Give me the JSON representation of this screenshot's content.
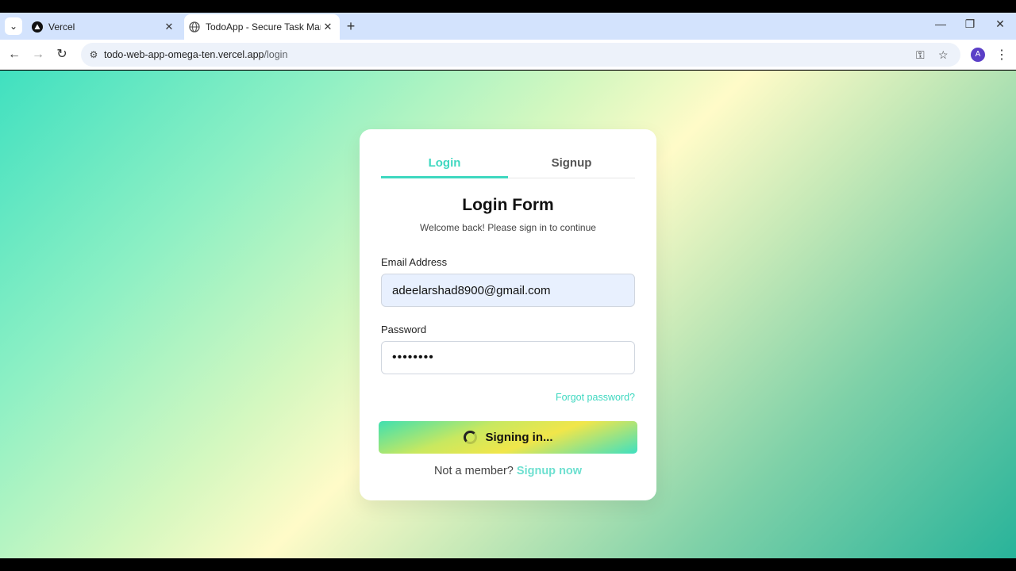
{
  "browser": {
    "tabs": [
      {
        "title": "Vercel",
        "active": false
      },
      {
        "title": "TodoApp - Secure Task Manage",
        "active": true
      }
    ],
    "url_host": "todo-web-app-omega-ten.vercel.app",
    "url_path": "/login",
    "profile_initial": "A"
  },
  "auth": {
    "tab_login": "Login",
    "tab_signup": "Signup",
    "title": "Login Form",
    "subtitle": "Welcome back! Please sign in to continue",
    "email_label": "Email Address",
    "email_value": "adeelarshad8900@gmail.com",
    "password_label": "Password",
    "password_mask": "••••••••",
    "forgot": "Forgot password?",
    "submit": "Signing in...",
    "not_member": "Not a member?",
    "signup_now": "Signup now"
  },
  "colors": {
    "accent": "#3fd8c0",
    "avatar": "#5b3fc7"
  }
}
